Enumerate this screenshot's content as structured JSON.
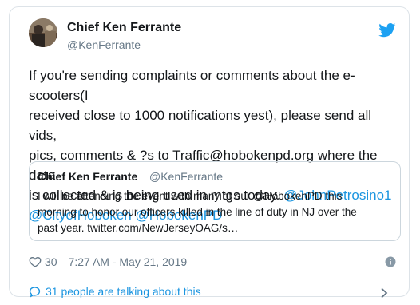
{
  "author": {
    "name": "Chief Ken Ferrante",
    "handle": "@KenFerrante"
  },
  "tweet": {
    "line1": "If you're sending complaints or comments about the e-scooters(I",
    "line2": "received close to 1000 notifications yest), please send all vids,",
    "line3": "pics, comments & ?s to Traffic@hobokenpd.org where the data",
    "line4_text": "is collected & is being used in mtgs today. ",
    "mention1": "@JohnPetrosino1",
    "mention2": "@CityofHoboken",
    "mention3": "@HobokenPD"
  },
  "quote": {
    "name": "Chief Ken Ferrante",
    "handle": "@KenFerrante",
    "line1": "I will be attending the event with many of our @HobokenPD this",
    "line2": "morning to honor our officers killed in the line of duty in NJ over the",
    "line3": "past year. twitter.com/NewJerseyOAG/s…"
  },
  "meta": {
    "likes": "30",
    "timestamp": "7:27 AM - May 21, 2019"
  },
  "footer": {
    "talking": "31 people are talking about this"
  },
  "icons": {
    "brand": "twitter-bird-icon",
    "like": "heart-icon",
    "info": "info-icon",
    "reply": "speech-bubble-icon",
    "expand": "chevron-right-icon"
  },
  "colors": {
    "link": "#1b95e0",
    "secondary_text": "#657786",
    "border": "#dde3e8"
  }
}
